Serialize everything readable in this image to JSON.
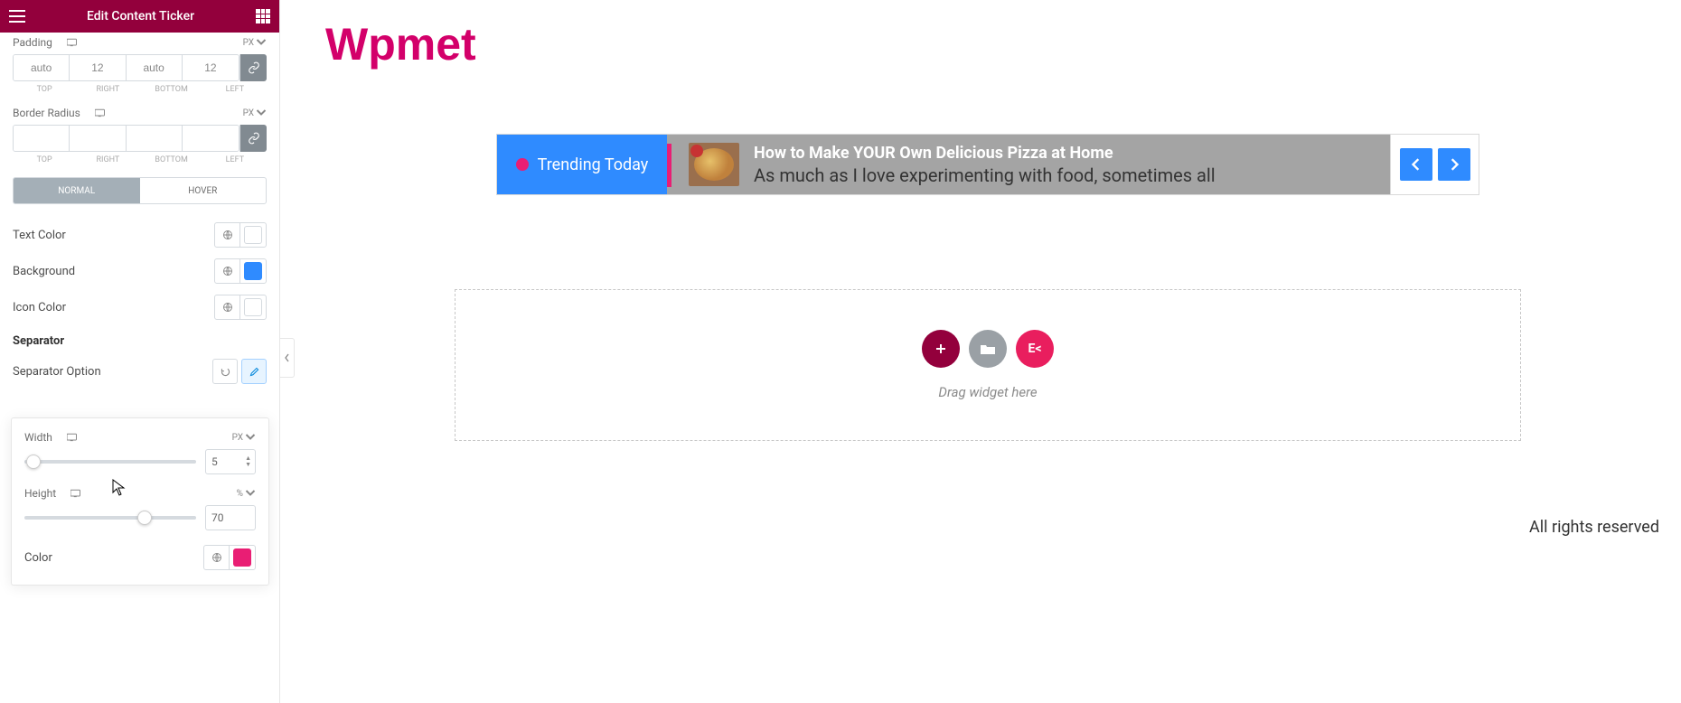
{
  "header": {
    "title": "Edit Content Ticker"
  },
  "padding": {
    "label": "Padding",
    "unit": "PX",
    "top": "auto",
    "right": "12",
    "bottom": "auto",
    "left": "12",
    "labels": {
      "top": "TOP",
      "right": "RIGHT",
      "bottom": "BOTTOM",
      "left": "LEFT"
    }
  },
  "border_radius": {
    "label": "Border Radius",
    "unit": "PX",
    "top": "",
    "right": "",
    "bottom": "",
    "left": "",
    "labels": {
      "top": "TOP",
      "right": "RIGHT",
      "bottom": "BOTTOM",
      "left": "LEFT"
    }
  },
  "tabs": {
    "normal": "NORMAL",
    "hover": "HOVER"
  },
  "text_color": {
    "label": "Text Color",
    "value": ""
  },
  "background": {
    "label": "Background",
    "value": "#2f8bff"
  },
  "icon_color": {
    "label": "Icon Color",
    "value": ""
  },
  "separator": {
    "heading": "Separator",
    "option_label": "Separator Option",
    "width": {
      "label": "Width",
      "unit": "PX",
      "value": "5"
    },
    "height": {
      "label": "Height",
      "unit": "%",
      "value": "70"
    },
    "color": {
      "label": "Color",
      "value": "#e91e74"
    }
  },
  "brand": "Wpmet",
  "ticker": {
    "badge": "Trending Today",
    "title": "How to Make YOUR Own Delicious Pizza at Home",
    "desc": "As much as I love experimenting with food, sometimes all"
  },
  "dropzone": {
    "hint": "Drag widget here",
    "ek_label": "E<"
  },
  "footer": "All rights reserved"
}
